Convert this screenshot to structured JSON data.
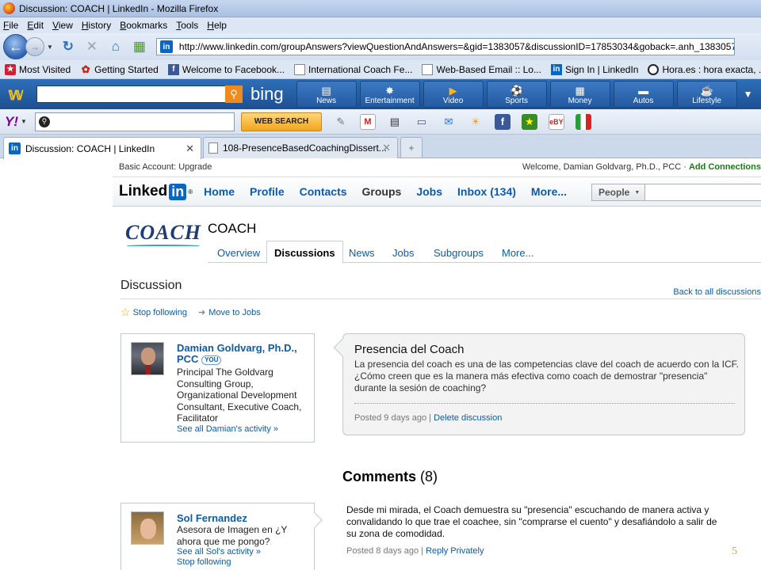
{
  "window": {
    "title": "Discussion: COACH | LinkedIn - Mozilla Firefox"
  },
  "menu": [
    "File",
    "Edit",
    "View",
    "History",
    "Bookmarks",
    "Tools",
    "Help"
  ],
  "address": {
    "url": "http://www.linkedin.com/groupAnswers?viewQuestionAndAnswers=&gid=1383057&discussionID=17853034&goback=.anh_1383057"
  },
  "bookmarks": [
    {
      "label": "Most Visited",
      "icon": "most-visited-icon"
    },
    {
      "label": "Getting Started",
      "icon": "getting-started-icon"
    },
    {
      "label": "Welcome to Facebook...",
      "icon": "facebook-icon"
    },
    {
      "label": "International Coach Fe...",
      "icon": "page-icon"
    },
    {
      "label": "Web-Based Email :: Lo...",
      "icon": "page-icon"
    },
    {
      "label": "Sign In | LinkedIn",
      "icon": "linkedin-icon"
    },
    {
      "label": "Hora.es : hora exacta, ...",
      "icon": "clock-icon"
    }
  ],
  "bing": {
    "logo_text": "bing",
    "tabs": [
      {
        "label": "News",
        "icon": "news-icon"
      },
      {
        "label": "Entertainment",
        "icon": "entertainment-icon"
      },
      {
        "label": "Video",
        "icon": "video-icon"
      },
      {
        "label": "Sports",
        "icon": "soccer-ball-icon"
      },
      {
        "label": "Money",
        "icon": "money-icon"
      },
      {
        "label": "Autos",
        "icon": "car-icon"
      },
      {
        "label": "Lifestyle",
        "icon": "coffee-cup-icon"
      }
    ]
  },
  "yahoo": {
    "logo": "Y!",
    "search_button": "WEB SEARCH"
  },
  "tabs": [
    {
      "label": "Discussion: COACH | LinkedIn",
      "active": true
    },
    {
      "label": "108-PresenceBasedCoachingDissert...",
      "active": false
    }
  ],
  "account": {
    "basic": "Basic Account: Upgrade",
    "welcome": "Welcome, Damian Goldvarg, Ph.D., PCC",
    "separator": " · ",
    "add_connections": "Add Connections"
  },
  "linkedin": {
    "logo_text": "Linked",
    "logo_in": "in",
    "logo_reg": "®",
    "nav": [
      "Home",
      "Profile",
      "Contacts",
      "Groups",
      "Jobs",
      "Inbox (134)",
      "More..."
    ],
    "search_scope": "People"
  },
  "group": {
    "logo_text": "COACH",
    "name": "COACH",
    "tabs": [
      "Overview",
      "Discussions",
      "News",
      "Jobs",
      "Subgroups",
      "More..."
    ],
    "active_tab": "Discussions"
  },
  "discussion": {
    "heading": "Discussion",
    "back_link": "Back to all discussions",
    "stop_following": "Stop following",
    "move_to_jobs": "Move to Jobs",
    "author": {
      "name": "Damian Goldvarg, Ph.D., PCC",
      "badge": "YOU",
      "title": "Principal The Goldvarg Consulting Group, Organizational Development Consultant, Executive Coach, Facilitator",
      "activity_link": "See all Damian's activity »"
    },
    "title": "Presencia del Coach",
    "body": "La presencia del coach es una de las competencias clave del coach de acuerdo con la ICF. ¿Cómo creen que es la manera más efectiva como coach de demostrar \"presencia\" durante la sesión de coaching?",
    "posted": "Posted 9 days ago",
    "meta_separator": " | ",
    "delete_link": "Delete discussion"
  },
  "comments": {
    "label": "Comments",
    "count": "(8)",
    "items": [
      {
        "name": "Sol Fernandez",
        "title": "Asesora de Imagen en ¿Y ahora que me pongo?",
        "activity_link": "See all Sol's activity »",
        "stop_following": "Stop following",
        "text": "Desde mi mirada, el Coach demuestra su \"presencia\" escuchando de manera activa y convalidando lo que trae el coachee, sin \"comprarse el cuento\" y desafiándolo a salir de su zona de comodidad.",
        "posted": "Posted 8 days ago",
        "reply_link": "Reply Privately"
      }
    ]
  },
  "slide_number": "5"
}
